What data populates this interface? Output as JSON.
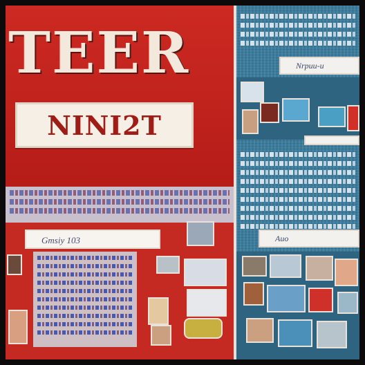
{
  "poster": {
    "title": "TEER",
    "subtitle": "NINI2T"
  },
  "search_left": {
    "text": "Gmsiy 103"
  },
  "search_right_top": {
    "text": "Nrpuu-u"
  },
  "search_right_bottom": {
    "text": "Auo"
  },
  "colors": {
    "poster_red": "#c4221c",
    "panel_blue": "#3a7a9a",
    "plate_cream": "#f6efe6"
  }
}
